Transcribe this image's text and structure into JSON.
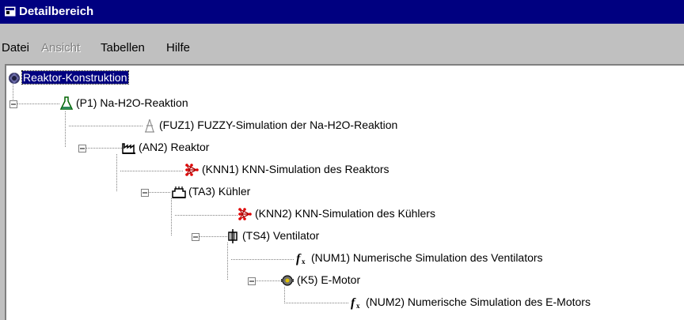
{
  "window": {
    "title": "Detailbereich",
    "icon": "window-app-icon"
  },
  "menu": [
    {
      "label": "Datei",
      "disabled": false
    },
    {
      "label": "Ansicht",
      "disabled": true
    },
    {
      "label": "Tabellen",
      "disabled": false
    },
    {
      "label": "Hilfe",
      "disabled": false
    }
  ],
  "tree": [
    {
      "label": "Reaktor-Konstruktion",
      "icon": "construction-icon",
      "selected": true,
      "expanded": true
    },
    {
      "label": "(P1) Na-H2O-Reaktion",
      "icon": "flask-icon",
      "expanded": true
    },
    {
      "label": "(FUZ1) FUZZY-Simulation der Na-H2O-Reaktion",
      "icon": "fuzzy-tower-icon"
    },
    {
      "label": "(AN2) Reaktor",
      "icon": "factory-icon",
      "expanded": true
    },
    {
      "label": "(KNN1) KNN-Simulation des Reaktors",
      "icon": "neural-net-icon"
    },
    {
      "label": "(TA3) Kühler",
      "icon": "cooler-icon",
      "expanded": true
    },
    {
      "label": "(KNN2) KNN-Simulation des Kühlers",
      "icon": "neural-net-icon"
    },
    {
      "label": "(TS4) Ventilator",
      "icon": "ventilator-icon",
      "expanded": true
    },
    {
      "label": "(NUM1) Numerische Simulation des Ventilators",
      "icon": "function-icon"
    },
    {
      "label": "(K5) E-Motor",
      "icon": "motor-icon",
      "expanded": true
    },
    {
      "label": "(NUM2) Numerische Simulation des E-Motors",
      "icon": "function-icon"
    }
  ],
  "colors": {
    "titlebar": "#000080",
    "selection": "#000080",
    "background": "#c0c0c0",
    "tree_bg": "#ffffff"
  }
}
